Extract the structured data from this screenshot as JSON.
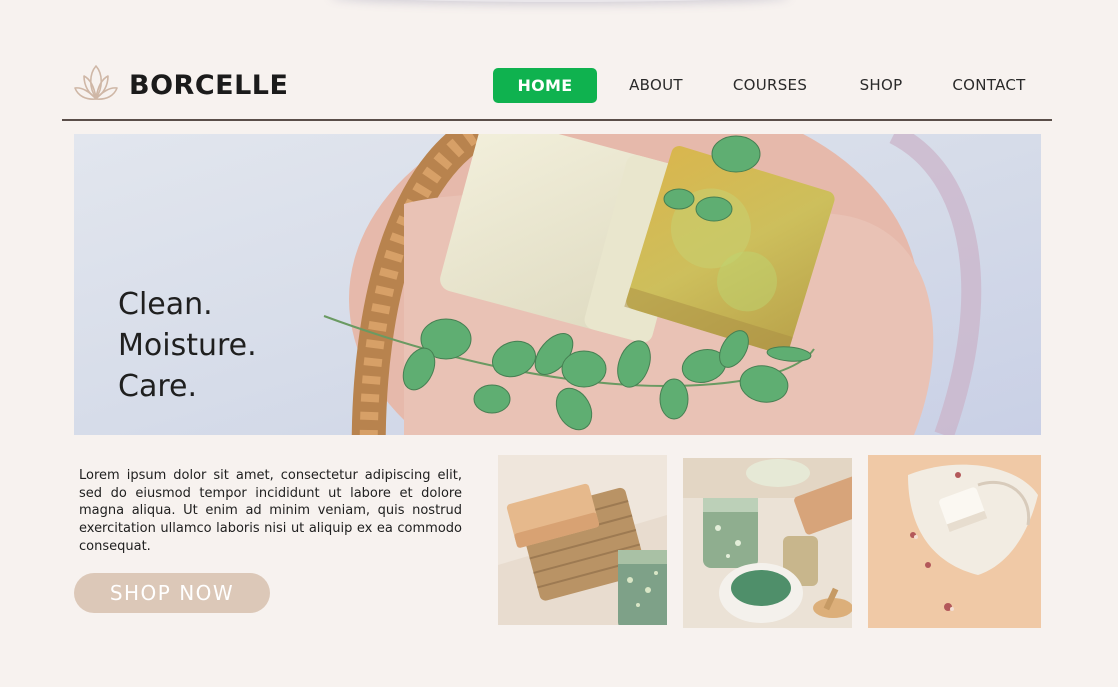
{
  "brand": {
    "name": "BORCELLE",
    "logo_icon": "lotus-icon"
  },
  "nav": {
    "items": [
      {
        "label": "HOME",
        "active": true
      },
      {
        "label": "ABOUT"
      },
      {
        "label": "COURSES"
      },
      {
        "label": "SHOP"
      },
      {
        "label": "CONTACT"
      }
    ]
  },
  "hero": {
    "lines": [
      "Clean.",
      "Moisture.",
      "Care."
    ]
  },
  "description": "Lorem ipsum dolor sit amet, consectetur adipiscing elit, sed do eiusmod tempor incididunt ut labore et dolore magna aliqua. Ut enim ad minim veniam, quis nostrud exercitation ullamco laboris nisi ut aliquip ex ea commodo consequat.",
  "cta": {
    "label": "SHOP NOW"
  },
  "colors": {
    "background": "#f7f2ef",
    "accent_green": "#0fb24f",
    "button_beige": "#dcc8b8",
    "divider": "#5a4e49"
  }
}
